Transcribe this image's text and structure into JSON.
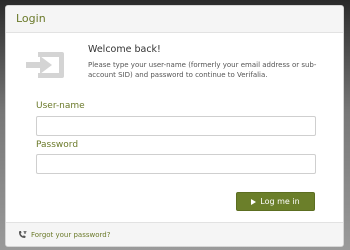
{
  "login_panel": {
    "title": "Login",
    "welcome_heading": "Welcome back!",
    "instructions": "Please type your user-name (formerly your email address or sub-account SID) and password to continue to Verifalia.",
    "login_icon": "sign-in-icon",
    "username": {
      "label": "User-name",
      "value": "",
      "placeholder": ""
    },
    "password": {
      "label": "Password",
      "value": "",
      "placeholder": ""
    },
    "submit": {
      "label": "Log me in",
      "icon": "play-icon"
    },
    "footer": {
      "forgot_password_label": "Forgot your password?",
      "icon": "phone-icon"
    }
  },
  "colors": {
    "accent": "#6b7a2a",
    "button": "#6b7f2a",
    "panel_header": "#f5f5f5",
    "icon_gray": "#d4d4d4"
  }
}
